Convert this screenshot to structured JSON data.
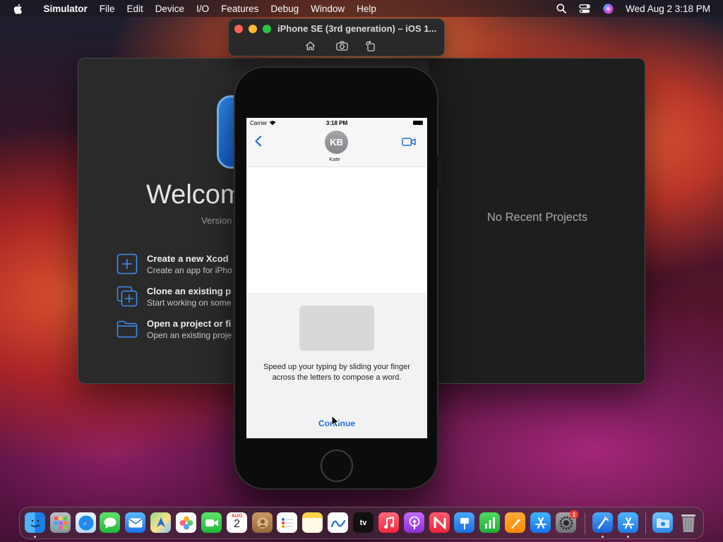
{
  "menubar": {
    "app_name": "Simulator",
    "menus": [
      "File",
      "Edit",
      "Device",
      "I/O",
      "Features",
      "Debug",
      "Window",
      "Help"
    ],
    "clock": "Wed Aug 2  3:18 PM"
  },
  "xcode": {
    "welcome_title": "Welcom",
    "version_label": "Version",
    "no_recent": "No Recent Projects",
    "actions": [
      {
        "title": "Create a new Xcod",
        "subtitle": "Create an app for iPho"
      },
      {
        "title": "Clone an existing p",
        "subtitle": "Start working on some"
      },
      {
        "title": "Open a project or fi",
        "subtitle": "Open an existing proje"
      }
    ]
  },
  "simulator": {
    "window_title": "iPhone SE (3rd generation) – iOS 1..."
  },
  "phone": {
    "status": {
      "carrier": "Carrier",
      "time": "3:18 PM"
    },
    "contact": {
      "initials": "KB",
      "name": "Kate"
    },
    "sheet": {
      "message": "Speed up your typing by sliding your finger across the letters to compose a word.",
      "continue_label": "Continue"
    }
  },
  "dock": {
    "calendar_month": "AUG",
    "calendar_day": "2",
    "tv_label": "tv",
    "settings_badge": "1",
    "apps": [
      "finder",
      "launchpad",
      "safari",
      "messages",
      "mail",
      "maps",
      "photos",
      "facetime",
      "calendar",
      "contacts",
      "reminders",
      "notes",
      "freeform",
      "tv",
      "music",
      "podcasts",
      "news",
      "keynote",
      "numbers",
      "pages",
      "app-store",
      "system-settings",
      "xcode",
      "simulator",
      "downloads",
      "trash"
    ]
  }
}
